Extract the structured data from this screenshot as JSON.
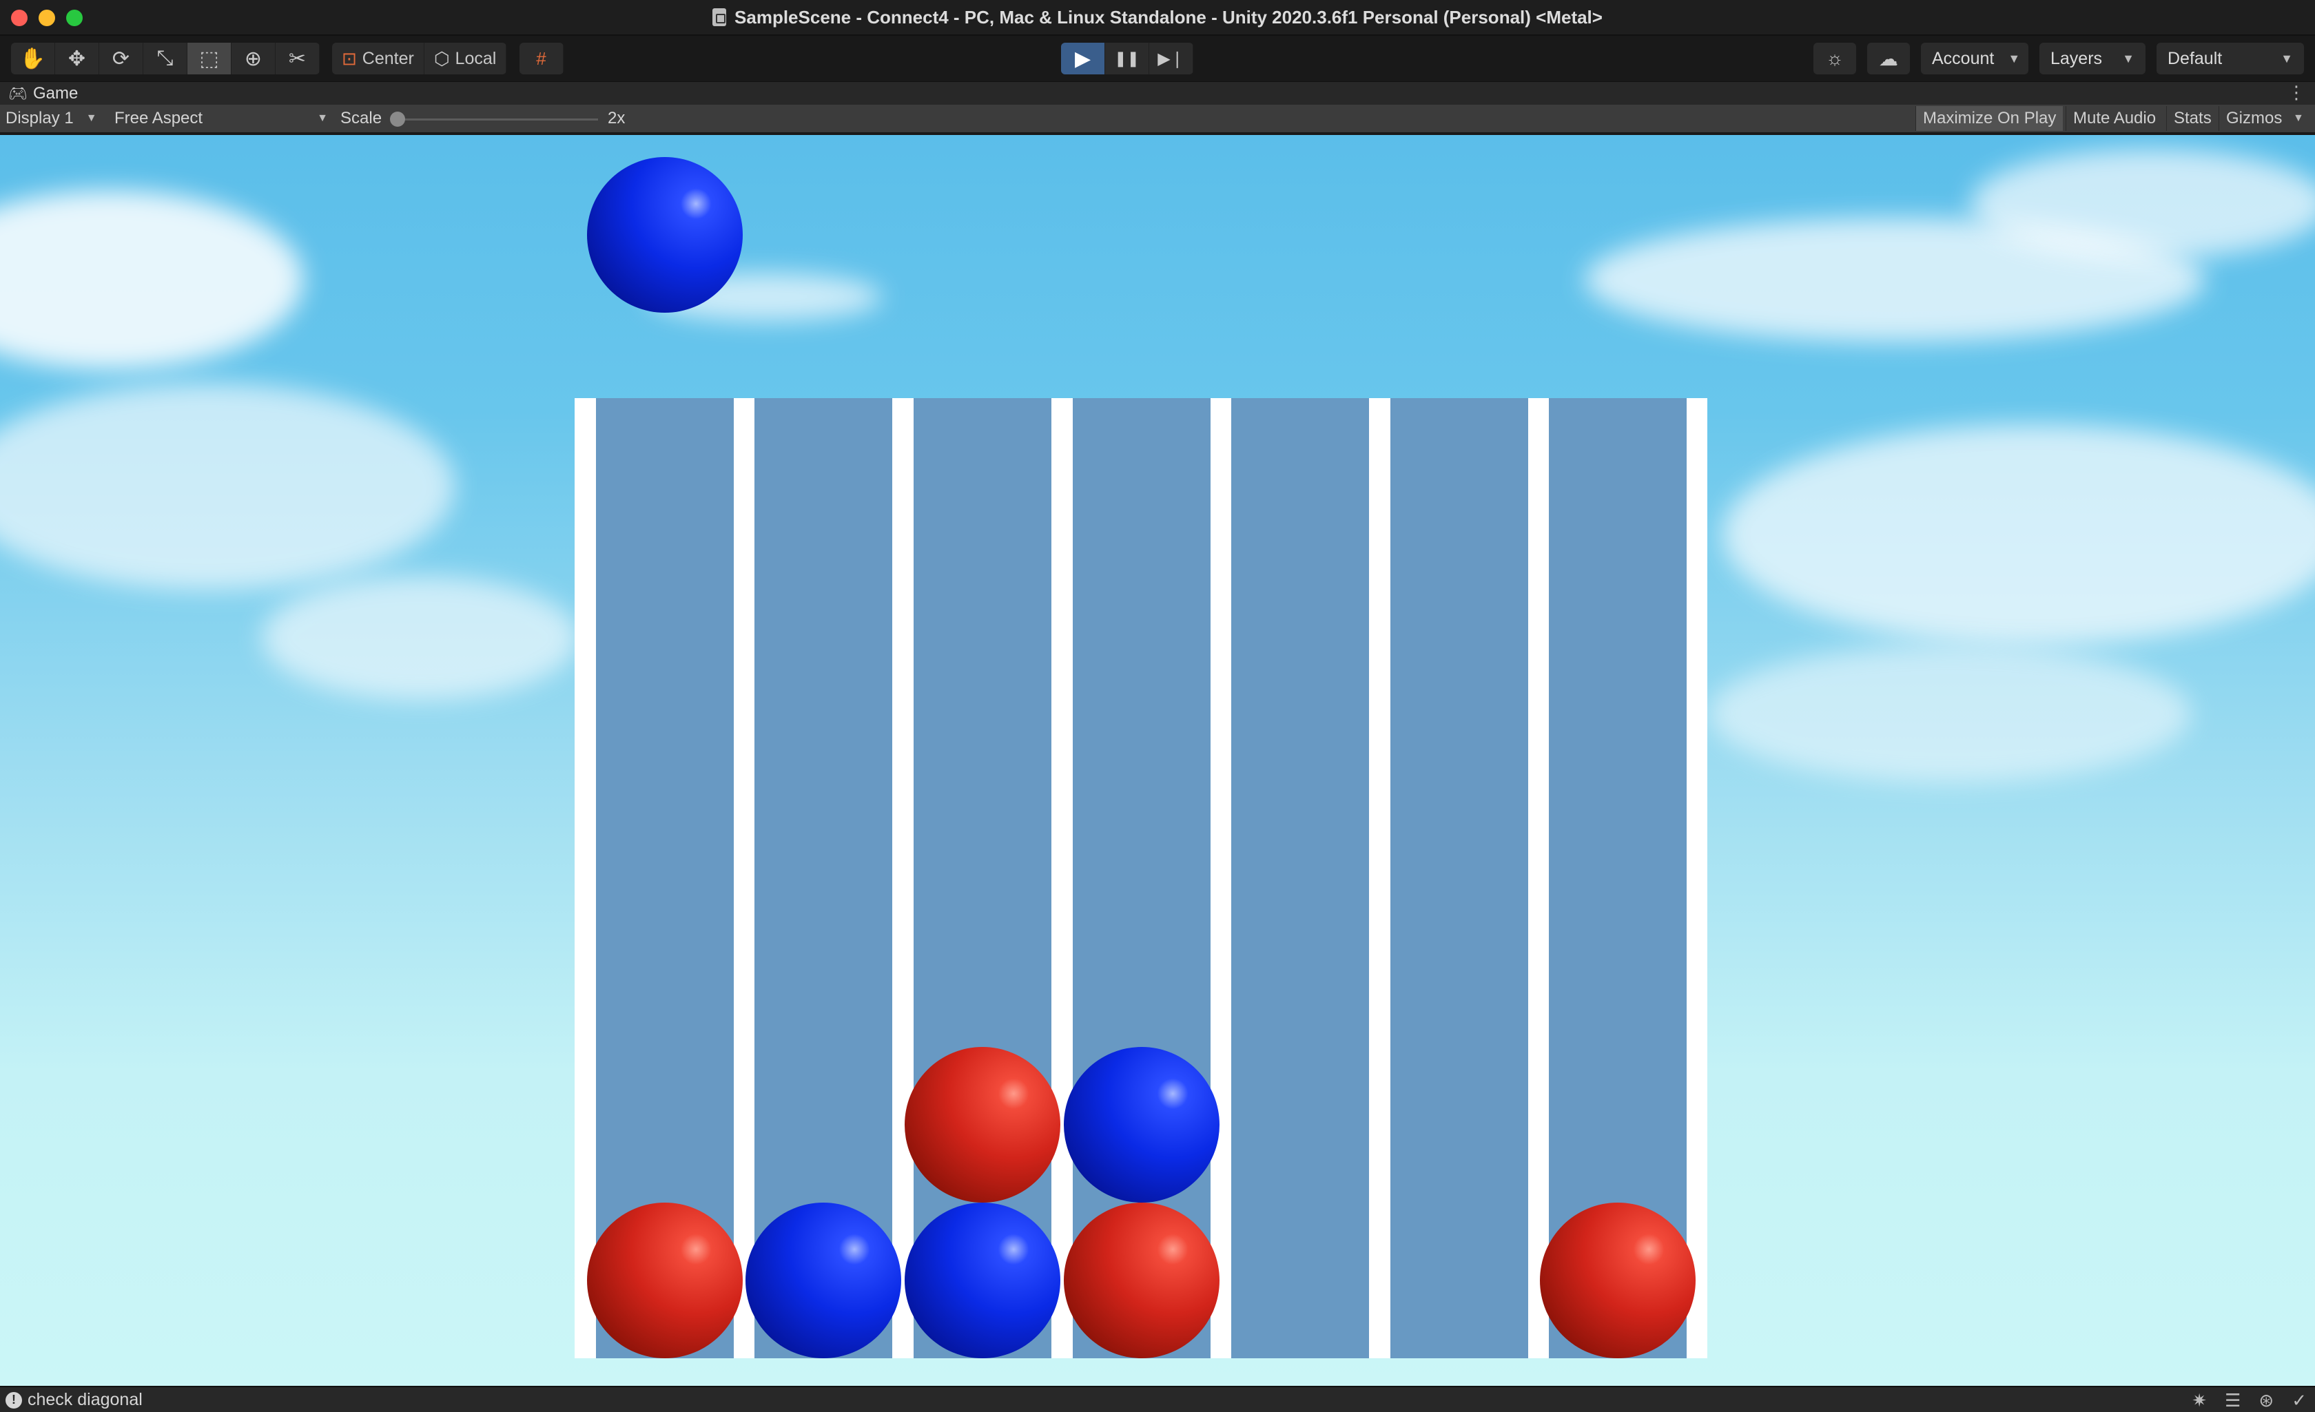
{
  "window": {
    "title": "SampleScene - Connect4 - PC, Mac & Linux Standalone - Unity 2020.3.6f1 Personal (Personal) <Metal>"
  },
  "toolbar": {
    "tools": [
      {
        "name": "hand-tool",
        "glyph": "✋"
      },
      {
        "name": "move-tool",
        "glyph": "✥"
      },
      {
        "name": "rotate-tool",
        "glyph": "⟳"
      },
      {
        "name": "scale-tool",
        "glyph": "⤡"
      },
      {
        "name": "rect-tool",
        "glyph": "⬚"
      },
      {
        "name": "transform-tool",
        "glyph": "⊕"
      },
      {
        "name": "custom-tool",
        "glyph": "✂"
      }
    ],
    "pivot_label": "Center",
    "space_label": "Local",
    "play": {
      "play_glyph": "▶",
      "pause_glyph": "❚❚",
      "step_glyph": "▶❘",
      "playing": true
    },
    "account_label": "Account",
    "layers_label": "Layers",
    "layout_label": "Default"
  },
  "tab": {
    "label": "Game"
  },
  "game_controls": {
    "display": "Display 1",
    "aspect": "Free Aspect",
    "scale_label": "Scale",
    "scale_value": "2x",
    "maximize_on_play": "Maximize On Play",
    "mute_audio": "Mute Audio",
    "stats": "Stats",
    "gizmos": "Gizmos"
  },
  "game": {
    "columns": 7,
    "rows_visible": 2,
    "board": [
      [
        "red",
        "blue",
        "blue",
        "red",
        "",
        "",
        "red"
      ],
      [
        "",
        "",
        "red",
        "blue",
        "",
        "",
        ""
      ]
    ],
    "hover_disc": {
      "color": "blue",
      "column": 1
    },
    "colors": {
      "red": "#d2241a",
      "blue": "#0a2ae6",
      "slot": "#6899c3",
      "frame": "#ffffff"
    }
  },
  "status": {
    "message": "check diagonal"
  }
}
